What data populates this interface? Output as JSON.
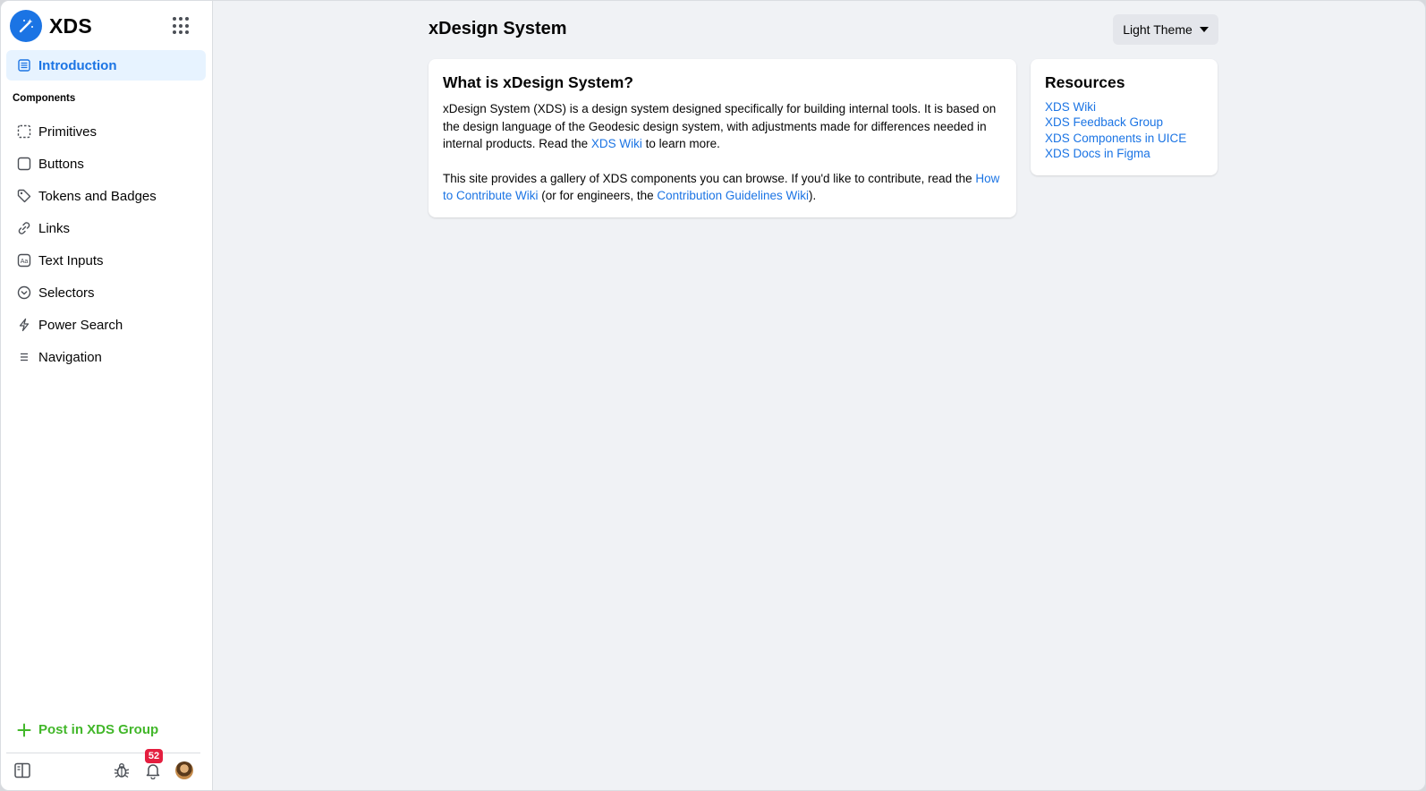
{
  "brand": {
    "title": "XDS"
  },
  "sidebar": {
    "active_item": "Introduction",
    "section_title": "Components",
    "items": [
      {
        "label": "Primitives",
        "icon": "dashed-square-icon"
      },
      {
        "label": "Buttons",
        "icon": "square-icon"
      },
      {
        "label": "Tokens and Badges",
        "icon": "tag-icon"
      },
      {
        "label": "Links",
        "icon": "link-icon"
      },
      {
        "label": "Text Inputs",
        "icon": "text-aa-icon"
      },
      {
        "label": "Selectors",
        "icon": "chevron-circle-icon"
      },
      {
        "label": "Power Search",
        "icon": "lightning-icon"
      },
      {
        "label": "Navigation",
        "icon": "menu-lines-icon"
      }
    ],
    "post_label": "Post in XDS Group",
    "notification_count": "52"
  },
  "header": {
    "title": "xDesign System",
    "theme_button": "Light Theme"
  },
  "intro_card": {
    "heading": "What is xDesign System?",
    "p1_text_a": "xDesign System (XDS) is a design system designed specifically for building internal tools. It is based on the design language of the Geodesic design system, with adjustments made for differences needed in internal products. Read the ",
    "p1_link": "XDS Wiki",
    "p1_text_b": " to learn more.",
    "p2_text_a": "This site provides a gallery of XDS components you can browse. If you'd like to contribute, read the ",
    "p2_link1": "How to Contribute Wiki",
    "p2_text_b": " (or for engineers, the ",
    "p2_link2": "Contribution Guidelines Wiki",
    "p2_text_c": ")."
  },
  "resources": {
    "heading": "Resources",
    "links": [
      "XDS Wiki",
      "XDS Feedback Group",
      "XDS Components in UICE",
      "XDS Docs in Figma"
    ]
  },
  "colors": {
    "accent": "#1b74e4",
    "active_bg": "#e7f3ff",
    "post_green": "#42b72a",
    "badge_red": "#e41e3f",
    "page_bg": "#f0f2f5"
  }
}
